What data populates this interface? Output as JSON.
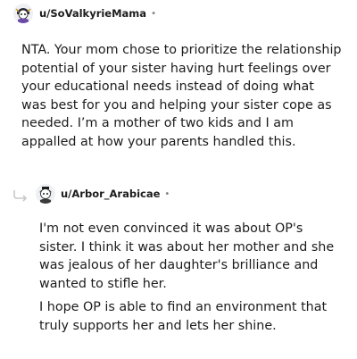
{
  "comments": [
    {
      "username": "u/SoValkyrieMama",
      "separator": "•",
      "avatar_icon": "snoo-avatar-icon",
      "paragraphs": [
        "NTA. Your mom chose to prioritize the relationship potential of your sister having hurt feelings over your educational needs instead of doing what was best for you and helping your sister cope as needed. I’m a mother of two kids and I am appalled at how your parents handled this."
      ]
    },
    {
      "username": "u/Arbor_Arabicae",
      "separator": "•",
      "avatar_icon": "snoo-avatar-icon",
      "reply_icon": "reply-arrow-icon",
      "paragraphs": [
        "I'm not even convinced it was about OP's sister. I think it was about her mother and she was jealous of her daughter's brilliance and wanted to stifle her.",
        "I hope OP is able to find an environment that truly supports her and lets her shine."
      ]
    }
  ],
  "colors": {
    "text": "#1c1c1c",
    "meta": "#7c7c7c",
    "reply_line": "#c8c8c8",
    "background": "#ffffff"
  }
}
